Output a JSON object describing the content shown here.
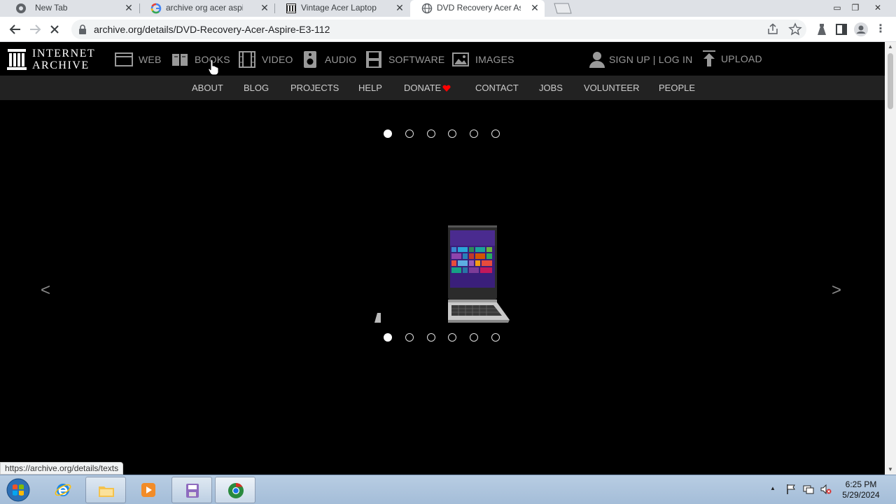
{
  "browser": {
    "tabs": [
      {
        "title": "New Tab",
        "active": false
      },
      {
        "title": "archive org acer aspire",
        "active": false
      },
      {
        "title": "Vintage Acer Laptop W",
        "active": false
      },
      {
        "title": "DVD Recovery Acer Asp",
        "active": true
      }
    ],
    "url": "archive.org/details/DVD-Recovery-Acer-Aspire-E3-112",
    "status_url": "https://archive.org/details/texts"
  },
  "ia": {
    "logo_line1": "INTERNET",
    "logo_line2": "ARCHIVE",
    "media": [
      {
        "label": "WEB",
        "icon": "web-icon"
      },
      {
        "label": "BOOKS",
        "icon": "books-icon"
      },
      {
        "label": "VIDEO",
        "icon": "film-icon"
      },
      {
        "label": "AUDIO",
        "icon": "speaker-icon"
      },
      {
        "label": "SOFTWARE",
        "icon": "floppy-icon"
      },
      {
        "label": "IMAGES",
        "icon": "image-icon"
      }
    ],
    "account": "SIGN UP | LOG IN",
    "upload": "UPLOAD",
    "subnav": [
      "ABOUT",
      "BLOG",
      "PROJECTS",
      "HELP",
      "DONATE",
      "CONTACT",
      "JOBS",
      "VOLUNTEER",
      "PEOPLE"
    ],
    "donate_color": "#ff0000"
  },
  "viewer": {
    "slide_count": 6,
    "current_slide": 1,
    "prev_label": "<",
    "next_label": ">"
  },
  "taskbar": {
    "time": "6:25 PM",
    "date": "5/29/2024",
    "tray_arrow": "▲"
  }
}
